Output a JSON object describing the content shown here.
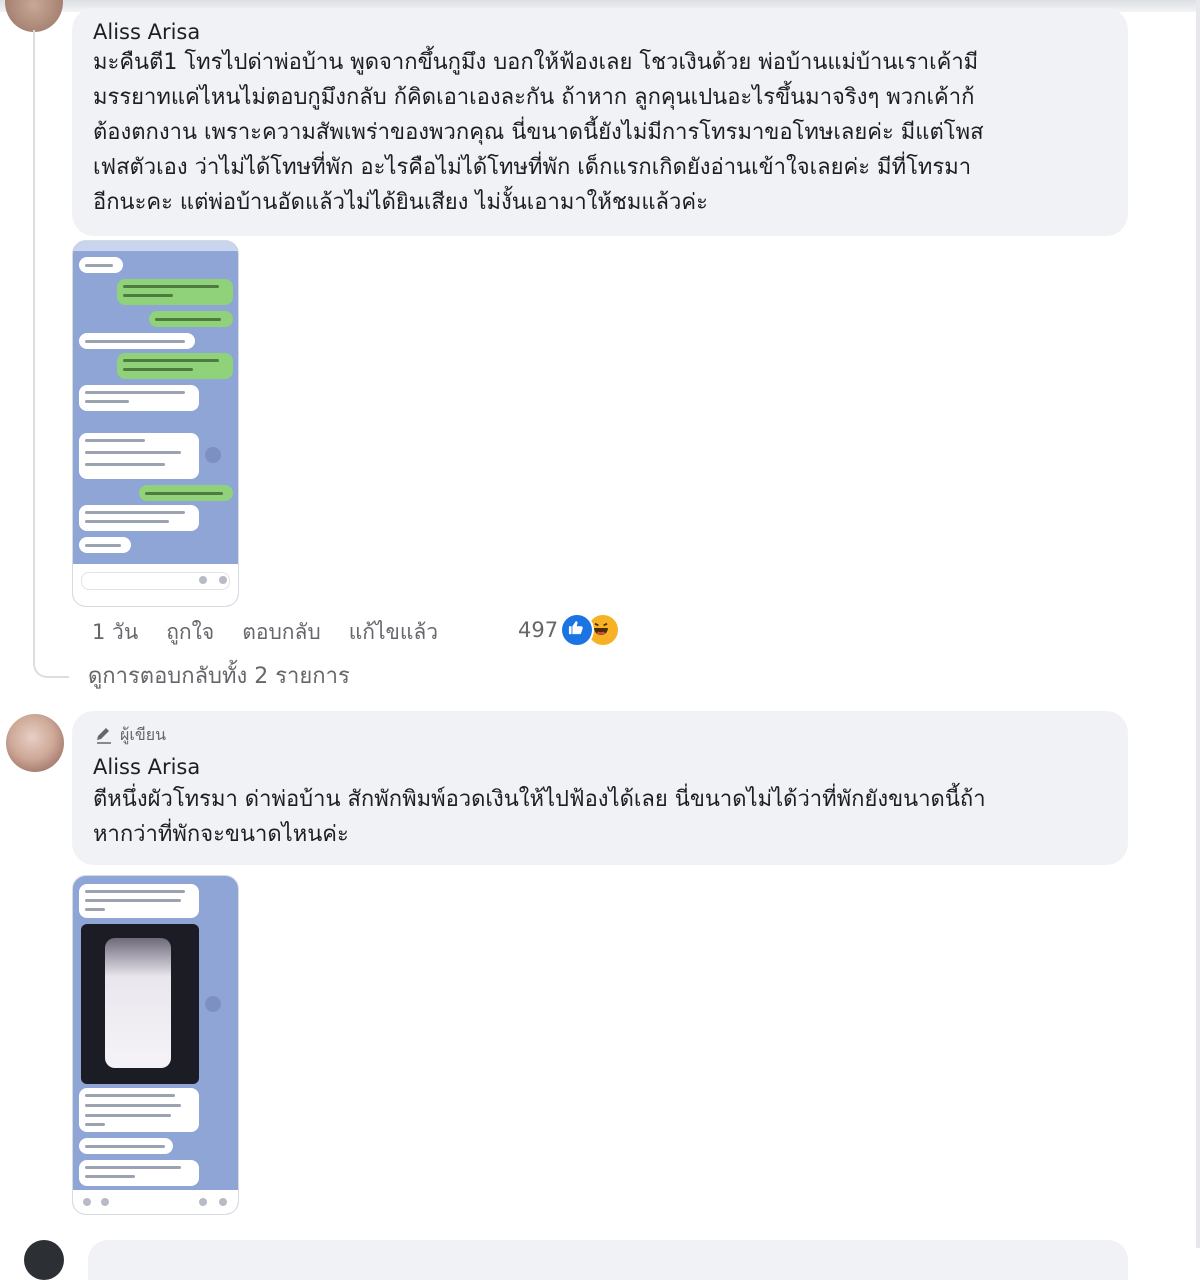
{
  "comments": [
    {
      "author": "Aliss Arisa",
      "text": "มะคืนตี1 โทรไปด่าพ่อบ้าน พูดจากขึ้นกูมึง บอกให้ฟ้องเลย โชวเงินด้วย พ่อบ้านแม่บ้านเราเค้ามี\nมรรยาทแค่ไหนไม่ตอบกูมึงกลับ ก้คิดเอาเองละกัน ถ้าหาก ลูกคุนเปนอะไรขึ้นมาจริงๆ พวกเค้าก้\nต้องตกงาน เพราะความสัพเพร่าของพวกคุณ นี่ขนาดนี้ยังไม่มีการโทรมาขอโทษเลยค่ะ มีแต่โพส\nเฟสตัวเอง ว่าไม่ได้โทษที่พัก อะไรคือไม่ได้โทษที่พัก เด็กแรกเกิดยังอ่านเข้าใจเลยค่ะ มีที่โทรมา\nอีกนะคะ แต่พ่อบ้านอัดแล้วไม่ได้ยินเสียง ไม่งั้นเอามาให้ชมแล้วค่ะ",
      "actions": {
        "time": "1 วัน",
        "like": "ถูกใจ",
        "reply": "ตอบกลับ",
        "edited": "แก้ไขแล้ว"
      },
      "reaction_count": "497",
      "reactions": [
        "like-icon",
        "haha-icon"
      ],
      "view_replies": "ดูการตอบกลับทั้ง 2 รายการ"
    },
    {
      "badge": "ผู้เขียน",
      "author": "Aliss Arisa",
      "text": "ตีหนึ่งผัวโทรมา ด่าพ่อบ้าน สักพักพิมพ์อวดเงินให้ไปฟ้องได้เลย นี่ขนาดไม่ได้ว่าที่พักยังขนาดนี้ถ้า\nหากว่าที่พักจะขนาดไหนค่ะ"
    }
  ],
  "colors": {
    "bubble": "#f0f2f5",
    "text": "#1c1e21",
    "meta": "#65676b",
    "like": "#1b74e4",
    "haha": "#f7b125"
  }
}
